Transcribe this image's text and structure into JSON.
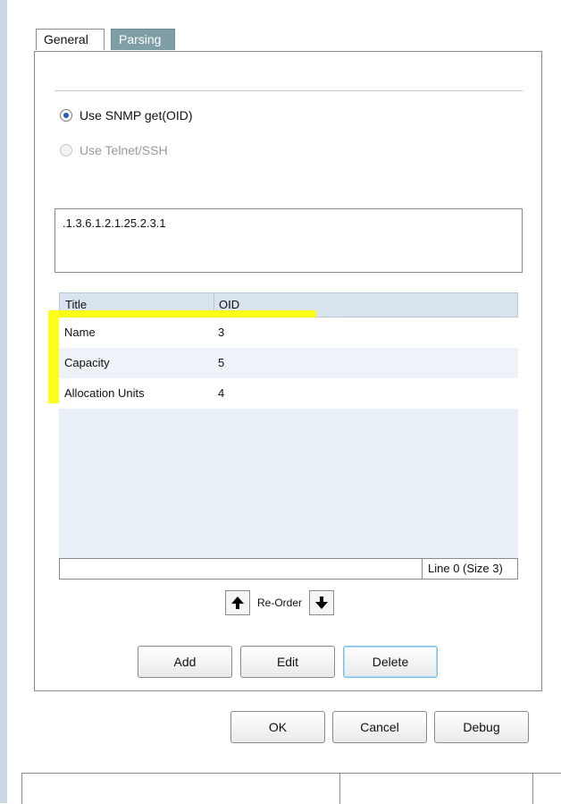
{
  "tabs": [
    {
      "label": "General"
    },
    {
      "label": "Parsing"
    }
  ],
  "method": {
    "snmp_label": "Use SNMP get(OID)",
    "telnet_label": "Use Telnet/SSH"
  },
  "oid_input": {
    "value": ".1.3.6.1.2.1.25.2.3.1"
  },
  "table": {
    "columns": [
      "Title",
      "OID"
    ],
    "rows": [
      {
        "title": "Name",
        "oid": "3"
      },
      {
        "title": "Capacity",
        "oid": "5"
      },
      {
        "title": "Allocation Units",
        "oid": "4"
      }
    ],
    "status": "Line 0 (Size 3)"
  },
  "reorder": {
    "label": "Re-Order"
  },
  "buttons": {
    "add": "Add",
    "edit": "Edit",
    "delete": "Delete",
    "ok": "OK",
    "cancel": "Cancel",
    "debug": "Debug"
  },
  "colors": {
    "highlight": "#ffff00",
    "tab_active": "#7f9fa6",
    "table_header": "#d8e3ee"
  }
}
